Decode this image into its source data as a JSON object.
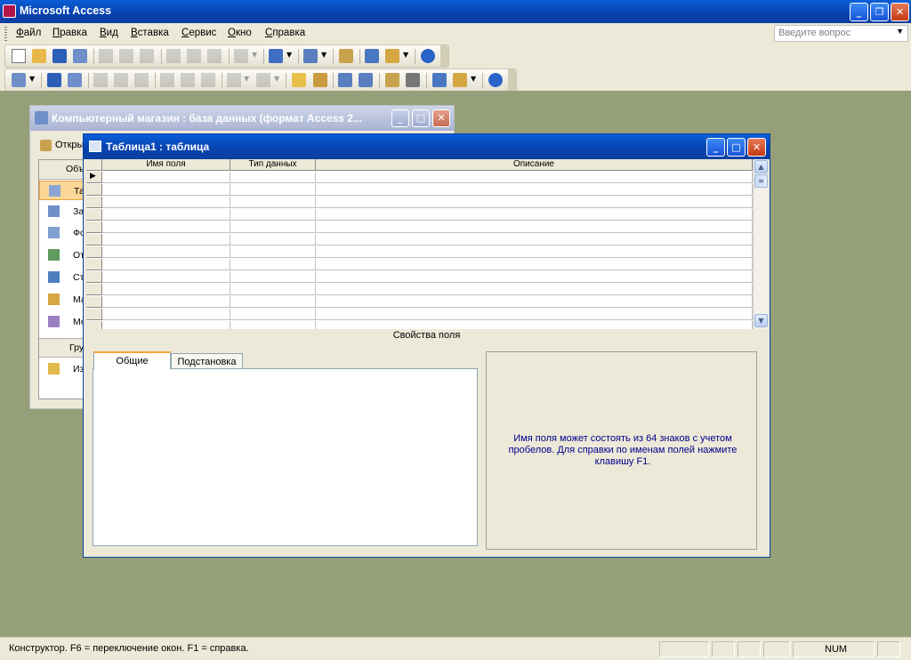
{
  "app": {
    "title": "Microsoft Access"
  },
  "menu": {
    "items": [
      "Файл",
      "Правка",
      "Вид",
      "Вставка",
      "Сервис",
      "Окно",
      "Справка"
    ]
  },
  "ask": {
    "placeholder": "Введите вопрос"
  },
  "toolbar1": {
    "icons": [
      "new-icon",
      "open-icon",
      "save-icon",
      "search-file-icon",
      "print-icon",
      "preview-icon",
      "spelling-icon",
      "cut-icon",
      "copy-icon",
      "paste-icon",
      "undo-icon",
      "office-links-icon",
      "analyze-icon",
      "properties-icon",
      "relationships-icon",
      "new-object-icon",
      "help-icon"
    ]
  },
  "toolbar2": {
    "icons": [
      "view-icon",
      "save-icon",
      "search-file-icon",
      "print-icon",
      "preview-icon",
      "spelling-icon",
      "cut-icon",
      "copy-icon",
      "paste-icon",
      "undo-icon",
      "redo-icon",
      "primary-key-icon",
      "indexes-icon",
      "insert-rows-icon",
      "delete-rows-icon",
      "properties-icon",
      "build-icon",
      "database-window-icon",
      "new-object-icon",
      "help-icon"
    ]
  },
  "dbwindow": {
    "title": "Компьютерный магазин : база данных (формат Access 2...",
    "open_label": "Откры",
    "objects_header": "Объ",
    "objects": [
      "Та",
      "За",
      "Фо",
      "От",
      "Ст",
      "Ма",
      "Мо"
    ],
    "groups_header": "Гру",
    "favorites": "Из"
  },
  "tablewindow": {
    "title": "Таблица1 : таблица",
    "columns": [
      "Имя поля",
      "Тип данных",
      "Описание"
    ],
    "field_properties_label": "Свойства поля",
    "tabs": [
      "Общие",
      "Подстановка"
    ],
    "help_text": "Имя поля может состоять из 64 знаков с учетом пробелов.  Для справки по именам полей нажмите клавишу F1."
  },
  "status": {
    "text": "Конструктор.  F6 = переключение окон.  F1 = справка.",
    "num": "NUM"
  },
  "colors": {
    "mdi_background": "#95a079",
    "titlebar_blue": "#0842b0",
    "help_text": "#00008b"
  }
}
